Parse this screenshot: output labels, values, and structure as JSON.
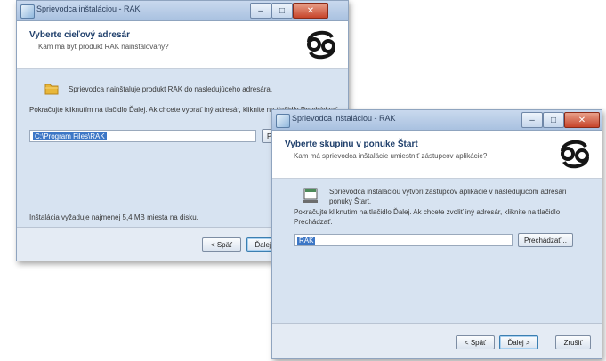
{
  "window1": {
    "title": "Sprievodca inštaláciou - RAK",
    "heading": "Vyberte cieľový adresár",
    "subheading": "Kam má byť produkt RAK nainštalovaný?",
    "info_text": "Sprievodca nainštaluje produkt RAK do nasledujúceho adresára.",
    "instruction_text": "Pokračujte kliknutím na tlačidlo Ďalej. Ak chcete vybrať iný adresár, kliknite na tlačidlo Prechádzať.",
    "path_value": "C:\\Program Files\\RAK",
    "browse_label": "Prechádzať...",
    "space_text": "Inštalácia vyžaduje najmenej 5,4 MB miesta na disku.",
    "back_label": "< Späť",
    "next_label": "Ďalej >"
  },
  "window2": {
    "title": "Sprievodca inštaláciou - RAK",
    "heading": "Vyberte skupinu v ponuke Štart",
    "subheading": "Kam má sprievodca inštalácie umiestniť zástupcov aplikácie?",
    "info_text": "Sprievodca inštaláciou vytvorí zástupcov aplikácie v nasledujúcom adresári ponuky Štart.",
    "instruction_text": "Pokračujte kliknutím na tlačidlo Ďalej. Ak chcete zvoliť iný adresár, kliknite na tlačidlo Prechádzať.",
    "group_value": "RAK",
    "browse_label": "Prechádzať...",
    "back_label": "< Späť",
    "next_label": "Ďalej >",
    "cancel_label": "Zrušiť"
  },
  "window_controls": {
    "minimize": "–",
    "maximize": "□",
    "close": "✕"
  }
}
